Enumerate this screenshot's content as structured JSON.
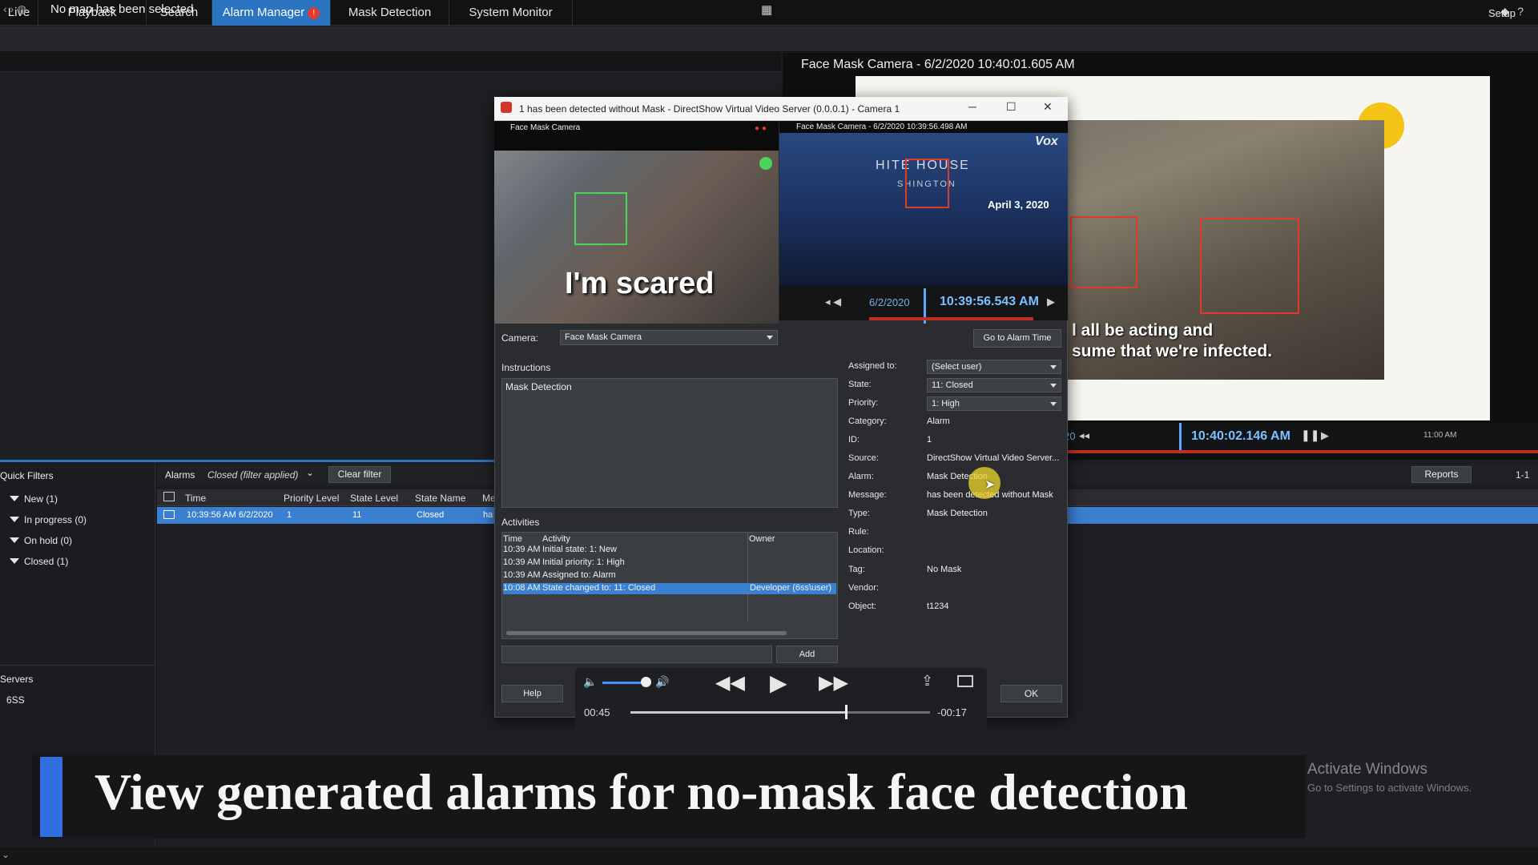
{
  "nav": {
    "tabs": [
      "Live",
      "Playback",
      "Search",
      "Alarm Manager",
      "Mask Detection",
      "System Monitor"
    ],
    "alarm_badge": "!",
    "setup": "Setup"
  },
  "map": {
    "title": "No map has been selected"
  },
  "camera_view": {
    "title": "Face Mask Camera - 6/2/2020 10:40:01.605 AM",
    "caption_line1": "l all be acting and",
    "caption_line2": "sume that we're infected.",
    "date": "6/2/2020",
    "time": "10:40:02.146 AM",
    "hour_tick": "11:00 AM"
  },
  "dialog": {
    "title": "1 has been detected without Mask - DirectShow Virtual Video Server (0.0.0.1) - Camera 1",
    "left_video": {
      "title": "Face Mask Camera",
      "caption": "I'm scared"
    },
    "right_video": {
      "title": "Face Mask Camera - 6/2/2020 10:39:56.498 AM",
      "sign_line1": "HITE HOUSE",
      "sign_line2": "SHINGTON",
      "sign_date": "April 3, 2020",
      "logo": "Vox",
      "date": "6/2/2020",
      "time": "10:39:56.543 AM"
    },
    "camera_label": "Camera:",
    "camera_value": "Face Mask Camera",
    "go_to_alarm_time": "Go to Alarm Time",
    "instructions_label": "Instructions",
    "instructions_text": "Mask Detection",
    "activities_label": "Activities",
    "activity_headers": [
      "Time",
      "Activity",
      "Owner"
    ],
    "activities": [
      {
        "time": "10:39 AM",
        "activity": "Initial state: 1: New",
        "owner": ""
      },
      {
        "time": "10:39 AM",
        "activity": "Initial priority: 1: High",
        "owner": ""
      },
      {
        "time": "10:39 AM",
        "activity": "Assigned to: Alarm",
        "owner": ""
      },
      {
        "time": "10:08 AM",
        "activity": "State changed to: 11: Closed",
        "owner": "Developer (6ss\\user)"
      }
    ],
    "add": "Add",
    "help": "Help",
    "ok": "OK",
    "properties": {
      "assigned_to_label": "Assigned to:",
      "assigned_to_value": "(Select user)",
      "state_label": "State:",
      "state_value": "11: Closed",
      "priority_label": "Priority:",
      "priority_value": "1: High",
      "category_label": "Category:",
      "category_value": "Alarm",
      "id_label": "ID:",
      "id_value": "1",
      "source_label": "Source:",
      "source_value": "DirectShow Virtual Video Server...",
      "alarm_label": "Alarm:",
      "alarm_value": "Mask Detection",
      "message_label": "Message:",
      "message_value": "has been detected without Mask",
      "type_label": "Type:",
      "type_value": "Mask Detection",
      "rule_label": "Rule:",
      "location_label": "Location:",
      "tag_label": "Tag:",
      "tag_value": "No Mask",
      "vendor_label": "Vendor:",
      "object_label": "Object:",
      "object_value": "t1234"
    }
  },
  "quick_filters": {
    "title": "Quick Filters",
    "items": [
      "New (1)",
      "In progress (0)",
      "On hold (0)",
      "Closed (1)"
    ],
    "servers_title": "Servers",
    "server": "6SS"
  },
  "alarms": {
    "label": "Alarms",
    "filter": "Closed (filter applied)",
    "clear_filter": "Clear filter",
    "reports": "Reports",
    "page": "1-1",
    "columns": [
      "Time",
      "Priority Level",
      "State Level",
      "State Name",
      "Me"
    ],
    "row": {
      "time": "10:39:56 AM 6/2/2020",
      "priority": "1",
      "state_level": "11",
      "state_name": "Closed",
      "message": "ha"
    }
  },
  "media": {
    "elapsed": "00:45",
    "remaining": "-00:17",
    "progress": 0.72
  },
  "banner": {
    "text": "View generated alarms for no-mask face detection"
  },
  "watermark": {
    "title": "Activate Windows",
    "subtitle": "Go to Settings to activate Windows."
  }
}
